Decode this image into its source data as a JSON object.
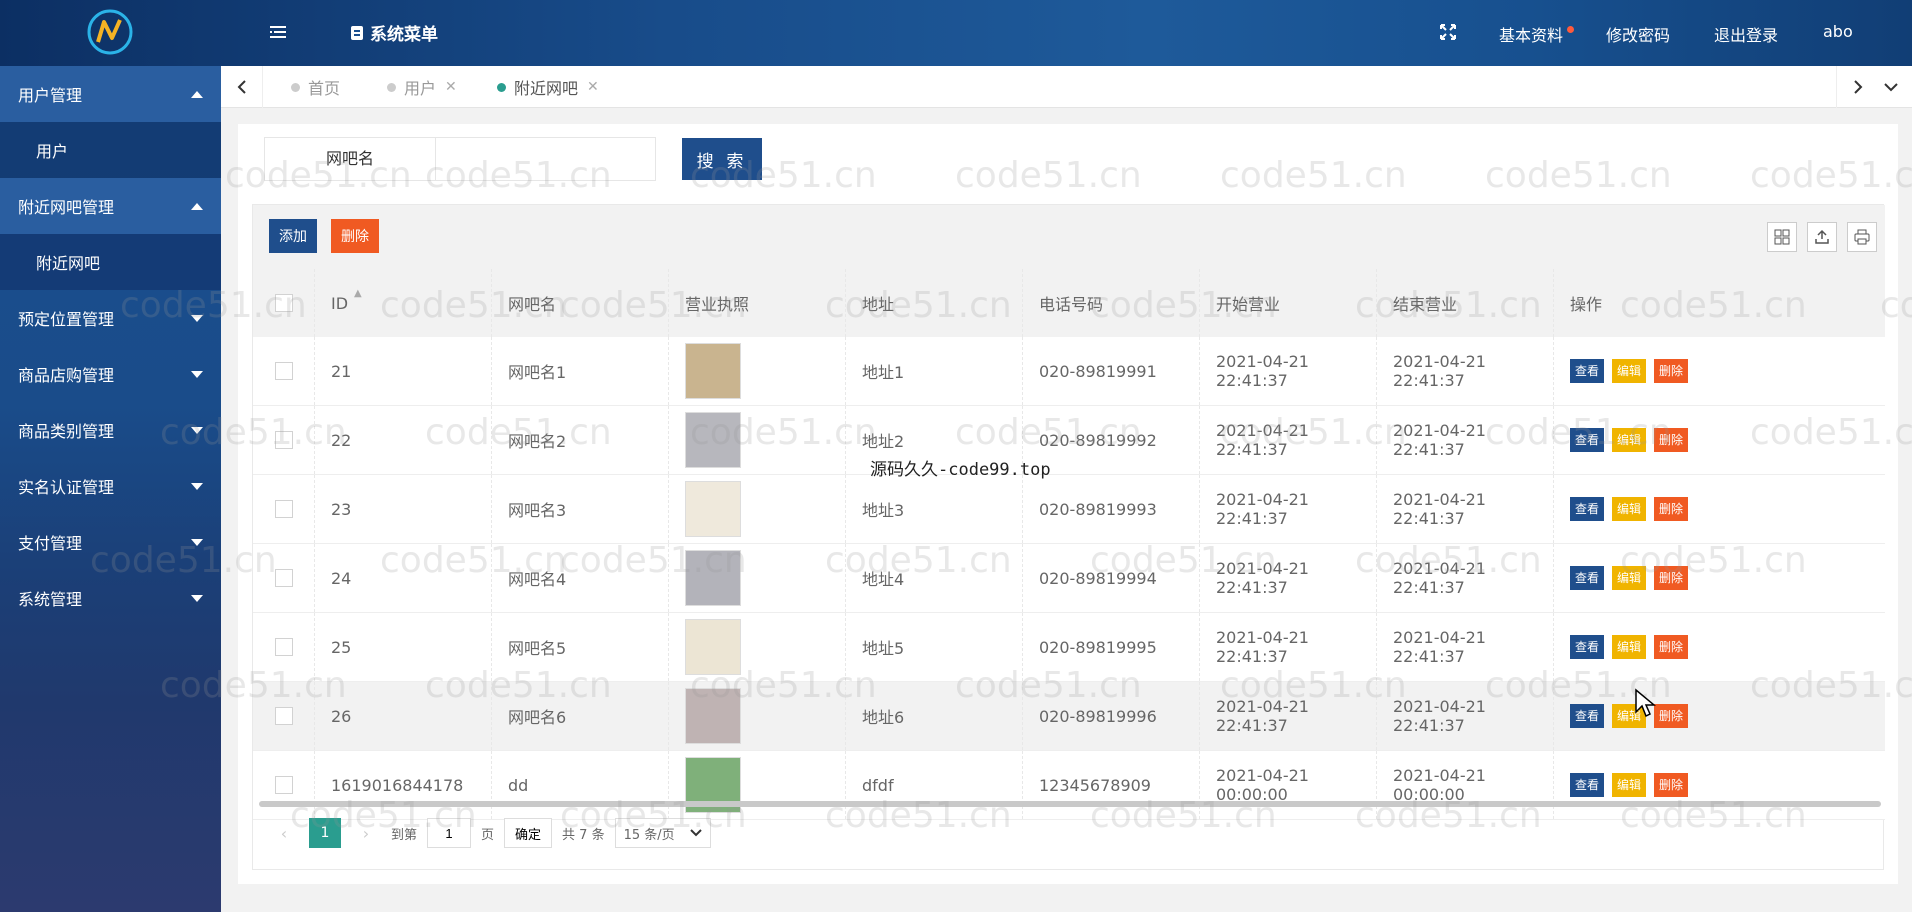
{
  "header": {
    "system_menu_label": "系统菜单",
    "links": {
      "profile": "基本资料",
      "change_password": "修改密码",
      "logout": "退出登录",
      "user": "abo"
    }
  },
  "sidebar": {
    "groups": [
      {
        "label": "用户管理",
        "open": true,
        "items": [
          {
            "label": "用户",
            "active": false
          }
        ]
      },
      {
        "label": "附近网吧管理",
        "open": true,
        "items": [
          {
            "label": "附近网吧",
            "active": true
          }
        ]
      },
      {
        "label": "预定位置管理",
        "open": false
      },
      {
        "label": "商品店购管理",
        "open": false
      },
      {
        "label": "商品类别管理",
        "open": false
      },
      {
        "label": "实名认证管理",
        "open": false
      },
      {
        "label": "支付管理",
        "open": false
      },
      {
        "label": "系统管理",
        "open": false
      }
    ]
  },
  "tabs": [
    {
      "label": "首页",
      "active": false,
      "closable": false
    },
    {
      "label": "用户",
      "active": false,
      "closable": true
    },
    {
      "label": "附近网吧",
      "active": true,
      "closable": true
    }
  ],
  "search": {
    "label": "网吧名",
    "value": "",
    "button": "搜 索"
  },
  "toolbar": {
    "add": "添加",
    "delete": "删除"
  },
  "table": {
    "columns": [
      "ID",
      "网吧名",
      "营业执照",
      "地址",
      "电话号码",
      "开始营业",
      "结束营业",
      "操作"
    ],
    "actions": {
      "view": "查看",
      "edit": "编辑",
      "delete": "删除"
    },
    "rows": [
      {
        "id": "21",
        "name": "网吧名1",
        "address": "地址1",
        "phone": "020-89819991",
        "start": "2021-04-21 22:41:37",
        "end": "2021-04-21 22:41:37",
        "thumb": "#c9b48f"
      },
      {
        "id": "22",
        "name": "网吧名2",
        "address": "地址2",
        "phone": "020-89819992",
        "start": "2021-04-21 22:41:37",
        "end": "2021-04-21 22:41:37",
        "thumb": "#b7b7bd"
      },
      {
        "id": "23",
        "name": "网吧名3",
        "address": "地址3",
        "phone": "020-89819993",
        "start": "2021-04-21 22:41:37",
        "end": "2021-04-21 22:41:37",
        "thumb": "#efe9dc"
      },
      {
        "id": "24",
        "name": "网吧名4",
        "address": "地址4",
        "phone": "020-89819994",
        "start": "2021-04-21 22:41:37",
        "end": "2021-04-21 22:41:37",
        "thumb": "#b3b3ba"
      },
      {
        "id": "25",
        "name": "网吧名5",
        "address": "地址5",
        "phone": "020-89819995",
        "start": "2021-04-21 22:41:37",
        "end": "2021-04-21 22:41:37",
        "thumb": "#ece5d4"
      },
      {
        "id": "26",
        "name": "网吧名6",
        "address": "地址6",
        "phone": "020-89819996",
        "start": "2021-04-21 22:41:37",
        "end": "2021-04-21 22:41:37",
        "thumb": "#bfb3b3"
      },
      {
        "id": "1619016844178",
        "name": "dd",
        "address": "dfdf",
        "phone": "12345678909",
        "start": "2021-04-21 00:00:00",
        "end": "2021-04-21 00:00:00",
        "thumb": "#7fb07a"
      }
    ]
  },
  "pager": {
    "current": "1",
    "goto_label": "到第",
    "page_value": "1",
    "page_unit": "页",
    "confirm": "确定",
    "total": "共 7 条",
    "page_size": "15 条/页"
  },
  "overlay_text": "源码久久-code99.top",
  "watermark_text": "code51.cn",
  "colors": {
    "primary": "#1f4e8c",
    "accent": "#2a9d8f",
    "warning": "#f0b400",
    "danger": "#f05a22"
  }
}
